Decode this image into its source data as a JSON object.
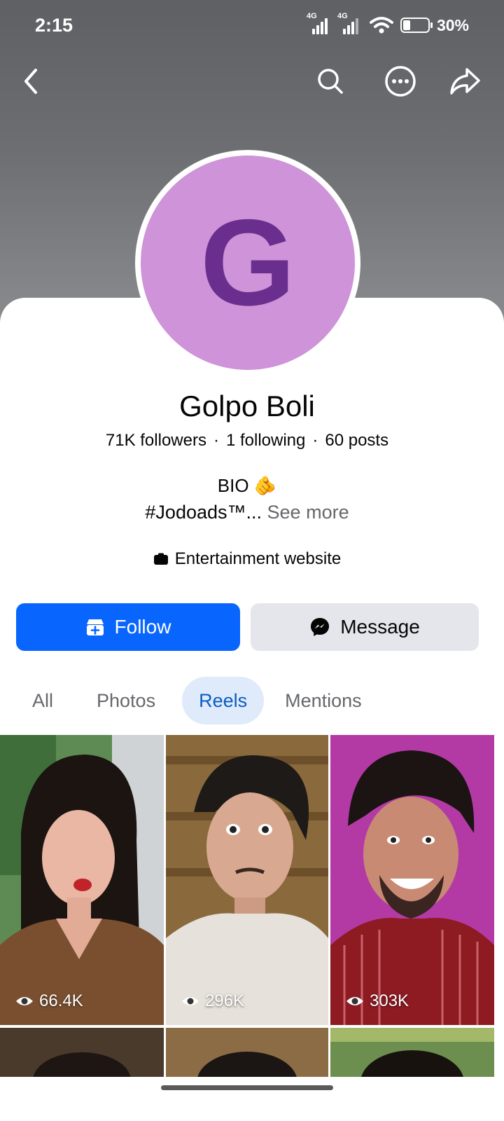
{
  "status_bar": {
    "time": "2:15",
    "network_1": "4G",
    "network_2": "4G",
    "battery_percent": "30%",
    "battery_level": 0.3
  },
  "nav": {
    "back_icon": "chevron-left-icon",
    "search_icon": "search-icon",
    "more_icon": "more-horizontal-icon",
    "share_icon": "share-icon"
  },
  "profile": {
    "avatar_letter": "G",
    "name": "Golpo Boli",
    "followers": "71K followers",
    "following": "1 following",
    "posts": "60 posts",
    "separator": "·",
    "bio_line1": "BIO 🫵",
    "bio_line2": "#Jodoads™...",
    "see_more": "See more",
    "category": "Entertainment website"
  },
  "actions": {
    "follow_label": "Follow",
    "message_label": "Message"
  },
  "tabs": [
    {
      "label": "All",
      "active": false
    },
    {
      "label": "Photos",
      "active": false
    },
    {
      "label": "Reels",
      "active": true
    },
    {
      "label": "Mentions",
      "active": false
    }
  ],
  "reels": [
    {
      "views": "66.4K"
    },
    {
      "views": "296K"
    },
    {
      "views": "303K"
    }
  ],
  "colors": {
    "accent": "#0866ff",
    "avatar_bg": "#ce93d8",
    "avatar_letter": "#6a2f8e",
    "tab_active_bg": "#dfeafb",
    "tab_active_text": "#0a5dc2"
  }
}
